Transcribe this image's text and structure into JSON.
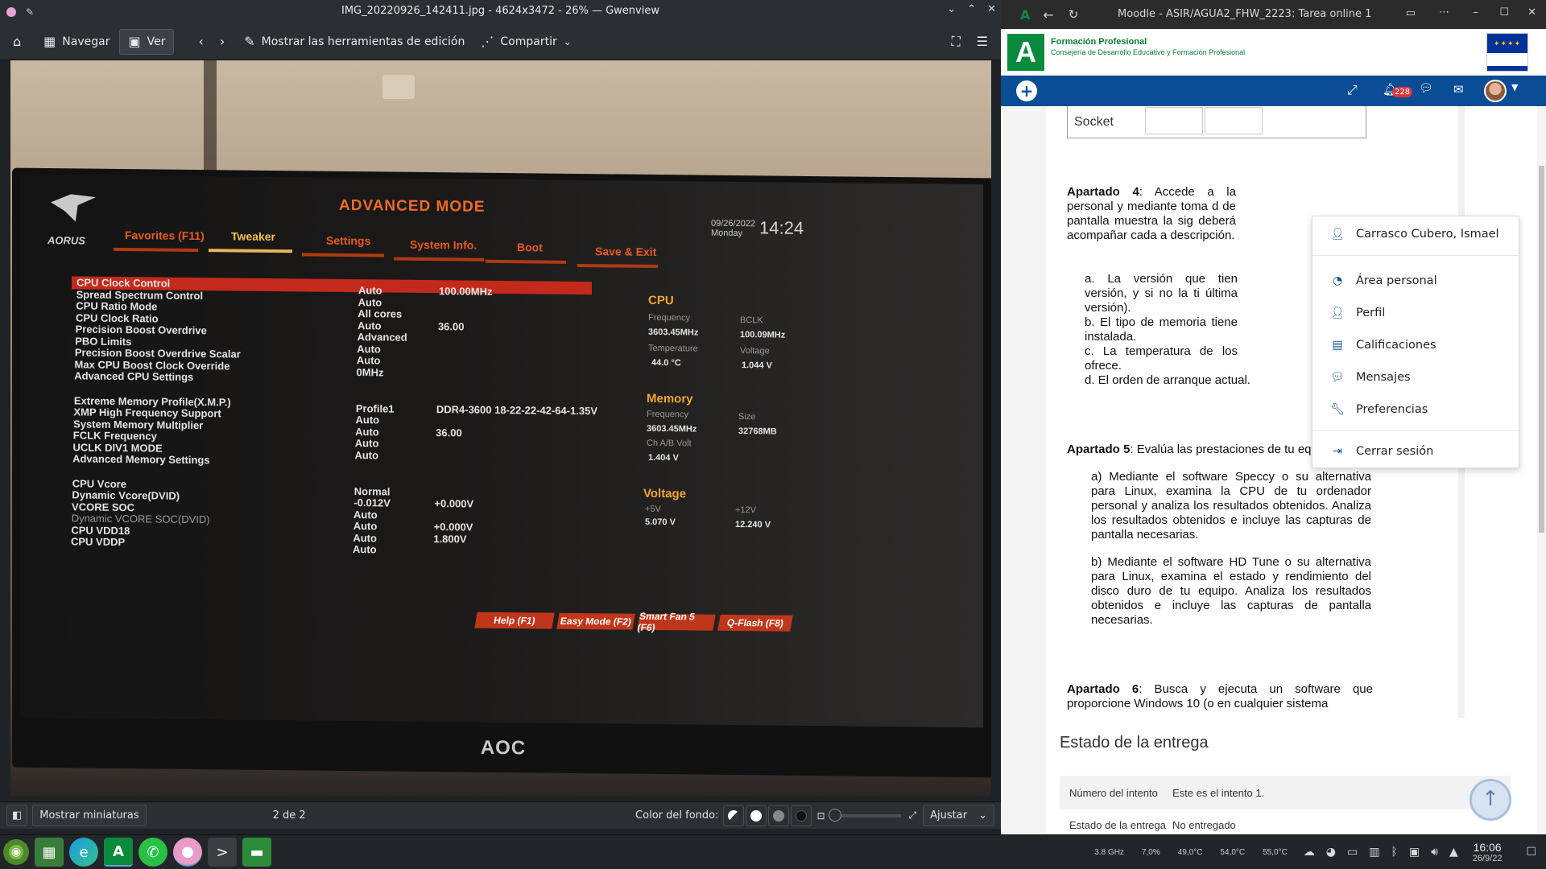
{
  "gwenview": {
    "title": "IMG_20220926_142411.jpg - 4624x3472 - 26% — Gwenview",
    "toolbar": {
      "navegar": "Navegar",
      "ver": "Ver",
      "edit_tools": "Mostrar las herramientas de edición",
      "share": "Compartir"
    },
    "statusbar": {
      "thumbnails": "Mostrar miniaturas",
      "page": "2 de 2",
      "bg_color_label": "Color del fondo:",
      "zoom_mode": "Ajustar"
    },
    "photo": {
      "monitor_brand": "AOC",
      "bios": {
        "mode_title": "ADVANCED MODE",
        "brand": "AORUS",
        "date": "09/26/2022",
        "day": "Monday",
        "time": "14:24",
        "tabs": [
          "Favorites (F11)",
          "Tweaker",
          "Settings",
          "System Info.",
          "Boot",
          "Save & Exit"
        ],
        "settings": [
          {
            "name": "CPU Clock Control",
            "value": "Auto",
            "extra": "100.00MHz"
          },
          {
            "name": "Spread Spectrum Control",
            "value": "Auto",
            "extra": ""
          },
          {
            "name": "CPU Ratio Mode",
            "value": "All cores",
            "extra": ""
          },
          {
            "name": "CPU Clock Ratio",
            "value": "Auto",
            "extra": "36.00"
          },
          {
            "name": "Precision Boost Overdrive",
            "value": "Advanced",
            "extra": ""
          },
          {
            "name": "PBO Limits",
            "value": "Auto",
            "extra": ""
          },
          {
            "name": "Precision Boost Overdrive Scalar",
            "value": "Auto",
            "extra": ""
          },
          {
            "name": "Max CPU Boost Clock Override",
            "value": "0MHz",
            "extra": ""
          },
          {
            "name": "Advanced CPU Settings",
            "value": "",
            "extra": ""
          },
          {
            "name": "Extreme Memory Profile(X.M.P.)",
            "value": "Profile1",
            "extra": "DDR4-3600 18-22-22-42-64-1.35V"
          },
          {
            "name": "XMP High Frequency Support",
            "value": "Auto",
            "extra": ""
          },
          {
            "name": "System Memory Multiplier",
            "value": "Auto",
            "extra": "36.00"
          },
          {
            "name": "FCLK Frequency",
            "value": "Auto",
            "extra": ""
          },
          {
            "name": "UCLK DIV1 MODE",
            "value": "Auto",
            "extra": ""
          },
          {
            "name": "Advanced Memory Settings",
            "value": "",
            "extra": ""
          },
          {
            "name": "CPU Vcore",
            "value": "Normal",
            "extra": ""
          },
          {
            "name": "Dynamic Vcore(DVID)",
            "value": "-0.012V",
            "extra": "+0.000V"
          },
          {
            "name": "VCORE SOC",
            "value": "Auto",
            "extra": ""
          },
          {
            "name": "Dynamic VCORE SOC(DVID)",
            "value": "Auto",
            "extra": "+0.000V"
          },
          {
            "name": "CPU VDD18",
            "value": "Auto",
            "extra": "1.800V"
          },
          {
            "name": "CPU VDDP",
            "value": "Auto",
            "extra": ""
          }
        ],
        "cpu": {
          "title": "CPU",
          "freq_label": "Frequency",
          "freq": "3603.45MHz",
          "bclk_label": "BCLK",
          "bclk": "100.09MHz",
          "temp_label": "Temperature",
          "temp": "44.0 °C",
          "volt_label": "Voltage",
          "volt": "1.044 V"
        },
        "memory": {
          "title": "Memory",
          "freq_label": "Frequency",
          "freq": "3603.45MHz",
          "size_label": "Size",
          "size": "32768MB",
          "volt_label": "Ch A/B Volt",
          "volt": "1.404 V"
        },
        "voltage": {
          "title": "Voltage",
          "v5_label": "+5V",
          "v5": "5.070 V",
          "v12_label": "+12V",
          "v12": "12.240 V"
        },
        "buttons": [
          "Help (F1)",
          "Easy Mode (F2)",
          "Smart Fan 5 (F6)",
          "Q-Flash (F8)"
        ]
      }
    }
  },
  "browser": {
    "title": "Moodle - ASIR/AGUA2_FHW_2223: Tarea online 1",
    "org_title": "Formación Profesional",
    "org_subtitle": "Consejería de Desarrollo Educativo y Formación Profesional",
    "notifications_count": "228",
    "socket_cell": "Socket",
    "user_menu": {
      "user_name": "Carrasco Cubero, Ismael",
      "items": [
        "Área personal",
        "Perfil",
        "Calificaciones",
        "Mensajes",
        "Preferencias"
      ],
      "logout": "Cerrar sesión"
    },
    "content": {
      "apartado4_head": "Apartado 4",
      "apartado4_text": ": Accede a la personal y mediante toma d de pantalla muestra la sig deberá acompañar cada a descripción.",
      "list4": [
        "a. La versión que tien versión, y si no la ti última versión).",
        "b. El tipo de memoria tiene instalada.",
        "c. La temperatura de los ofrece.",
        "d. El orden de arranque actual."
      ],
      "apartado5_head": "Apartado 5",
      "apartado5_text": ": Evalúa las prestaciones de tu equipo:",
      "item5a": "a) Mediante el software Speccy o su alternativa para Linux, examina la CPU de tu ordenador personal y analiza los resultados obtenidos. Analiza los resultados obtenidos e incluye las capturas de pantalla necesarias.",
      "item5b": "b) Mediante el software HD Tune o su alternativa para Linux, examina el estado y rendimiento del disco duro de tu equipo. Analiza los resultados obtenidos e incluye las capturas de pantalla necesarias.",
      "apartado6_head": "Apartado 6",
      "apartado6_text": ": Busca y ejecuta un software que proporcione Windows 10 (o en cualquier sistema"
    },
    "submission": {
      "heading": "Estado de la entrega",
      "attempt_label": "Número del intento",
      "attempt_value": "Este es el intento 1.",
      "status_label": "Estado de la entrega",
      "status_value": "No entregado"
    }
  },
  "taskbar": {
    "cpu_freq": "3.8 GHz",
    "cpu_load": "7,0%",
    "temp1": "49,0°C",
    "temp2": "54,0°C",
    "temp3": "55,0°C",
    "time": "16:06",
    "date": "26/9/22"
  },
  "colors": {
    "moodle_blue": "#0b4d95",
    "junta_green": "#0a8a3c",
    "bios_accent": "#e75a22"
  }
}
